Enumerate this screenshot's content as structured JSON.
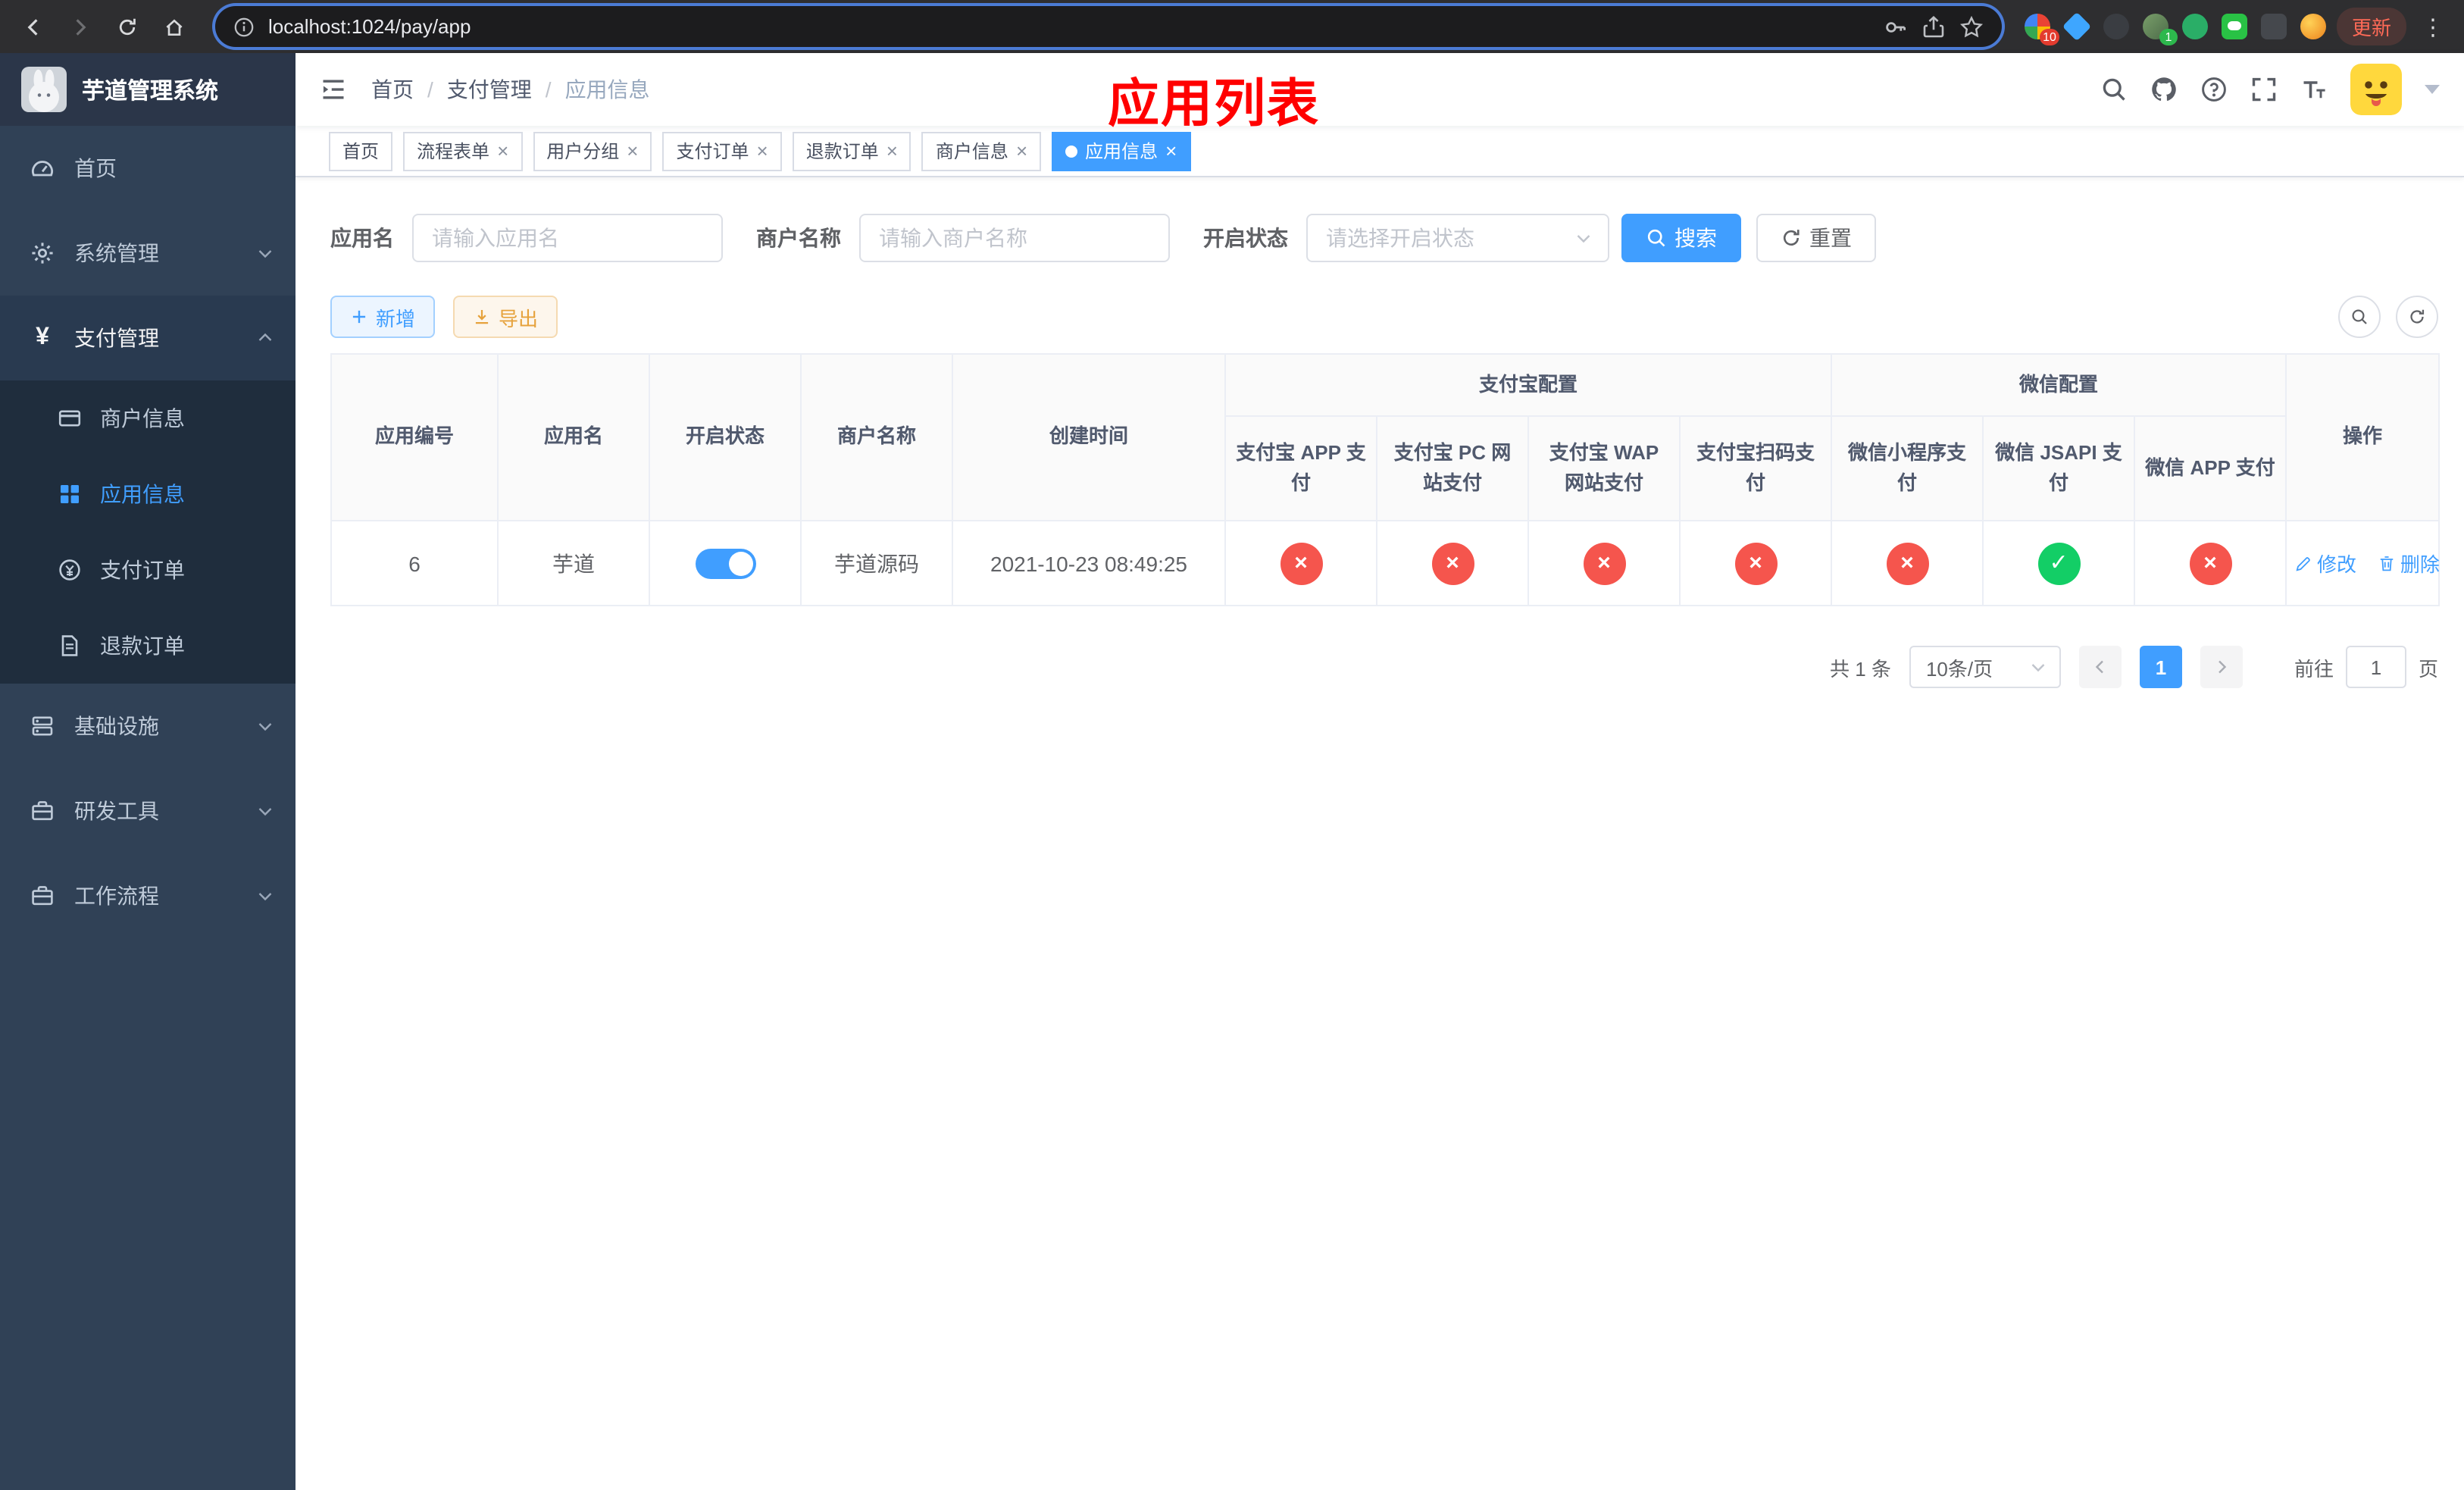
{
  "browser": {
    "url": "localhost:1024/pay/app",
    "update_label": "更新",
    "ext_badges": {
      "apps": "10",
      "profile": "1"
    }
  },
  "sidebar": {
    "logo_title": "芋道管理系统",
    "items": {
      "home": "首页",
      "system": "系统管理",
      "payment": "支付管理",
      "merchant_info": "商户信息",
      "app_info": "应用信息",
      "pay_order": "支付订单",
      "refund_order": "退款订单",
      "infra": "基础设施",
      "dev_tools": "研发工具",
      "workflow": "工作流程"
    }
  },
  "header": {
    "breadcrumb": {
      "home": "首页",
      "section": "支付管理",
      "current": "应用信息"
    },
    "overlay_title": "应用列表"
  },
  "tabs": [
    {
      "label": "首页"
    },
    {
      "label": "流程表单"
    },
    {
      "label": "用户分组"
    },
    {
      "label": "支付订单"
    },
    {
      "label": "退款订单"
    },
    {
      "label": "商户信息"
    },
    {
      "label": "应用信息"
    }
  ],
  "filters": {
    "app_name_label": "应用名",
    "app_name_placeholder": "请输入应用名",
    "merchant_label": "商户名称",
    "merchant_placeholder": "请输入商户名称",
    "status_label": "开启状态",
    "status_placeholder": "请选择开启状态",
    "search_button": "搜索",
    "reset_button": "重置"
  },
  "toolbar": {
    "add_button": "新增",
    "export_button": "导出"
  },
  "table": {
    "columns": {
      "app_id": "应用编号",
      "app_name": "应用名",
      "status": "开启状态",
      "merchant": "商户名称",
      "created_at": "创建时间",
      "alipay_group": "支付宝配置",
      "alipay_app": "支付宝 APP 支付",
      "alipay_pc": "支付宝 PC 网站支付",
      "alipay_wap": "支付宝 WAP 网站支付",
      "alipay_qr": "支付宝扫码支付",
      "wechat_group": "微信配置",
      "wechat_mini": "微信小程序支付",
      "wechat_jsapi": "微信 JSAPI 支付",
      "wechat_app": "微信 APP 支付",
      "actions": "操作"
    },
    "rows": [
      {
        "app_id": "6",
        "app_name": "芋道",
        "status_on": true,
        "merchant": "芋道源码",
        "created_at": "2021-10-23 08:49:25",
        "channels": {
          "alipay_app": false,
          "alipay_pc": false,
          "alipay_wap": false,
          "alipay_qr": false,
          "wechat_mini": false,
          "wechat_jsapi": true,
          "wechat_app": false
        },
        "edit_label": "修改",
        "delete_label": "删除"
      }
    ]
  },
  "pagination": {
    "total_text": "共 1 条",
    "page_size": "10条/页",
    "current_page": "1",
    "goto_label": "前往",
    "goto_value": "1",
    "page_unit_label": "页"
  },
  "icons": {
    "check": "✓",
    "cross": "×"
  },
  "colors": {
    "primary": "#409eff",
    "danger": "#f5554d",
    "success": "#13ce66",
    "sidebar_bg": "#304156",
    "submenu_bg": "#1f2d3d",
    "annotation_red": "#ff0000"
  }
}
